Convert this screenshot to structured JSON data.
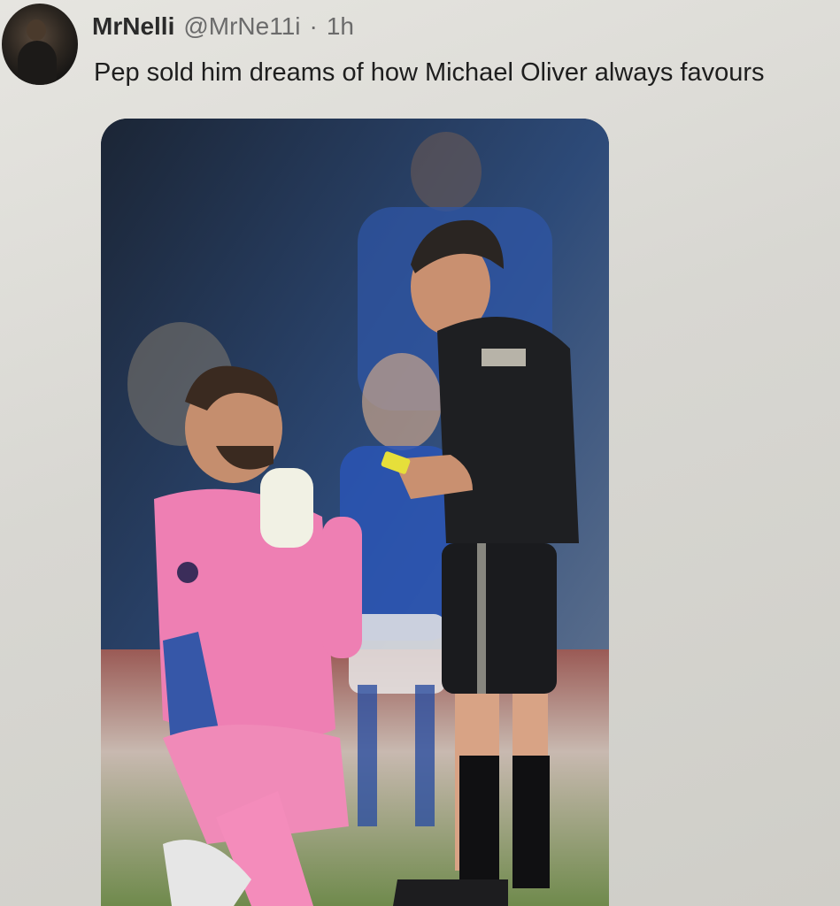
{
  "tweet": {
    "author_name": "MrNelli",
    "handle": "@MrNe11i",
    "separator": "·",
    "time": "1h",
    "text": "Pep sold him dreams of how Michael Oliver always favours",
    "avatar": "profile-avatar",
    "media": "photo-goalkeeper-kneeling-before-referee"
  },
  "colors": {
    "background": "#d9d8d3",
    "name": "#2a2a2a",
    "meta": "#6b6b6b",
    "text": "#1e1e1e"
  }
}
